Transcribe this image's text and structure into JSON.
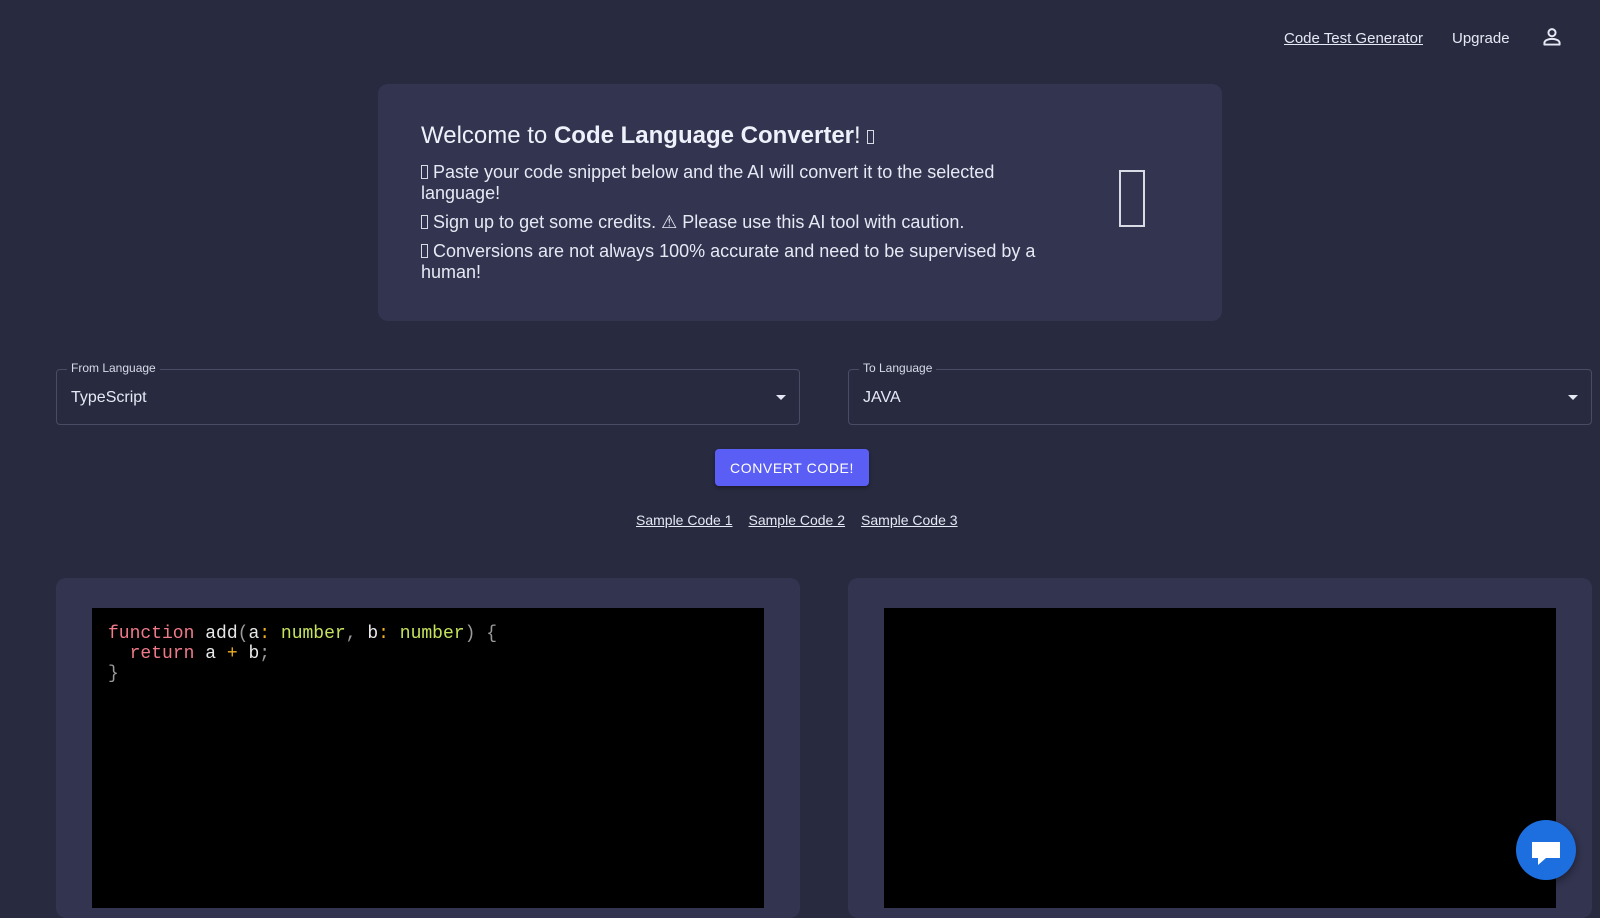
{
  "nav": {
    "code_test_generator": "Code Test Generator",
    "upgrade": "Upgrade",
    "user_icon": "account-icon"
  },
  "welcome": {
    "title_prefix": "Welcome to",
    "title_brand": "Code Language Converter",
    "title_suffix": "!",
    "line1": "Paste your code snippet below and the AI will convert it to the selected language!",
    "line2": "Sign up to get some credits. ⚠ Please use this AI tool with caution.",
    "line3": "Conversions are not always 100% accurate and need to be supervised by a human!",
    "icon": "placeholder-glyph-icon"
  },
  "from_language": {
    "label": "From Language",
    "value": "TypeScript"
  },
  "to_language": {
    "label": "To Language",
    "value": "JAVA"
  },
  "convert_button": "CONVERT CODE!",
  "samples": [
    "Sample Code 1",
    "Sample Code 2",
    "Sample Code 3"
  ],
  "input_code": {
    "kw_function": "function",
    "fn_name": "add",
    "p_a": "a",
    "type_number": "number",
    "p_b": "b",
    "kw_return": "return",
    "expr_a": "a",
    "op_plus": "+",
    "expr_b": "b"
  },
  "output_code": "",
  "colors": {
    "background": "#282a40",
    "card": "#323450",
    "accent": "#5b5ef4",
    "chat": "#1d6fe0"
  },
  "chat_icon": "chat-bubble-icon"
}
